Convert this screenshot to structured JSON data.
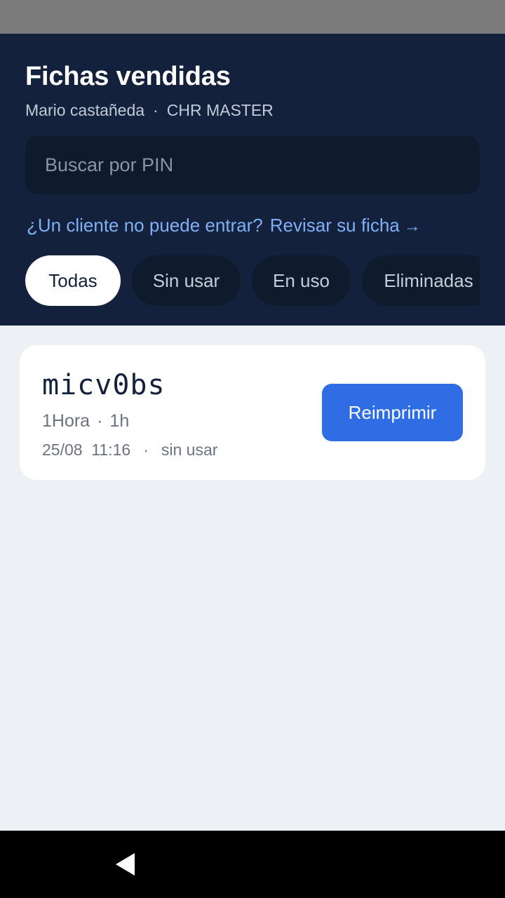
{
  "header": {
    "title": "Fichas vendidas",
    "user": "Mario castañeda",
    "separator": "·",
    "role": "CHR MASTER"
  },
  "search": {
    "placeholder": "Buscar por PIN",
    "value": ""
  },
  "help": {
    "question": "¿Un cliente no puede entrar?",
    "link": "Revisar su ficha",
    "arrow": "→"
  },
  "filters": [
    {
      "label": "Todas",
      "active": true
    },
    {
      "label": "Sin usar",
      "active": false
    },
    {
      "label": "En uso",
      "active": false
    },
    {
      "label": "Eliminadas",
      "active": false
    }
  ],
  "tickets": [
    {
      "pin": "micv0bs",
      "plan": "1Hora",
      "separator": "·",
      "duration": "1h",
      "date": "25/08",
      "time": "11:16",
      "status": "sin usar",
      "action": "Reimprimir"
    }
  ],
  "colors": {
    "header_bg": "#14213d",
    "accent": "#2f6de4",
    "link": "#7fb0f5",
    "page_bg": "#edf0f5"
  },
  "icons": {
    "back": "back-triangle-icon"
  }
}
